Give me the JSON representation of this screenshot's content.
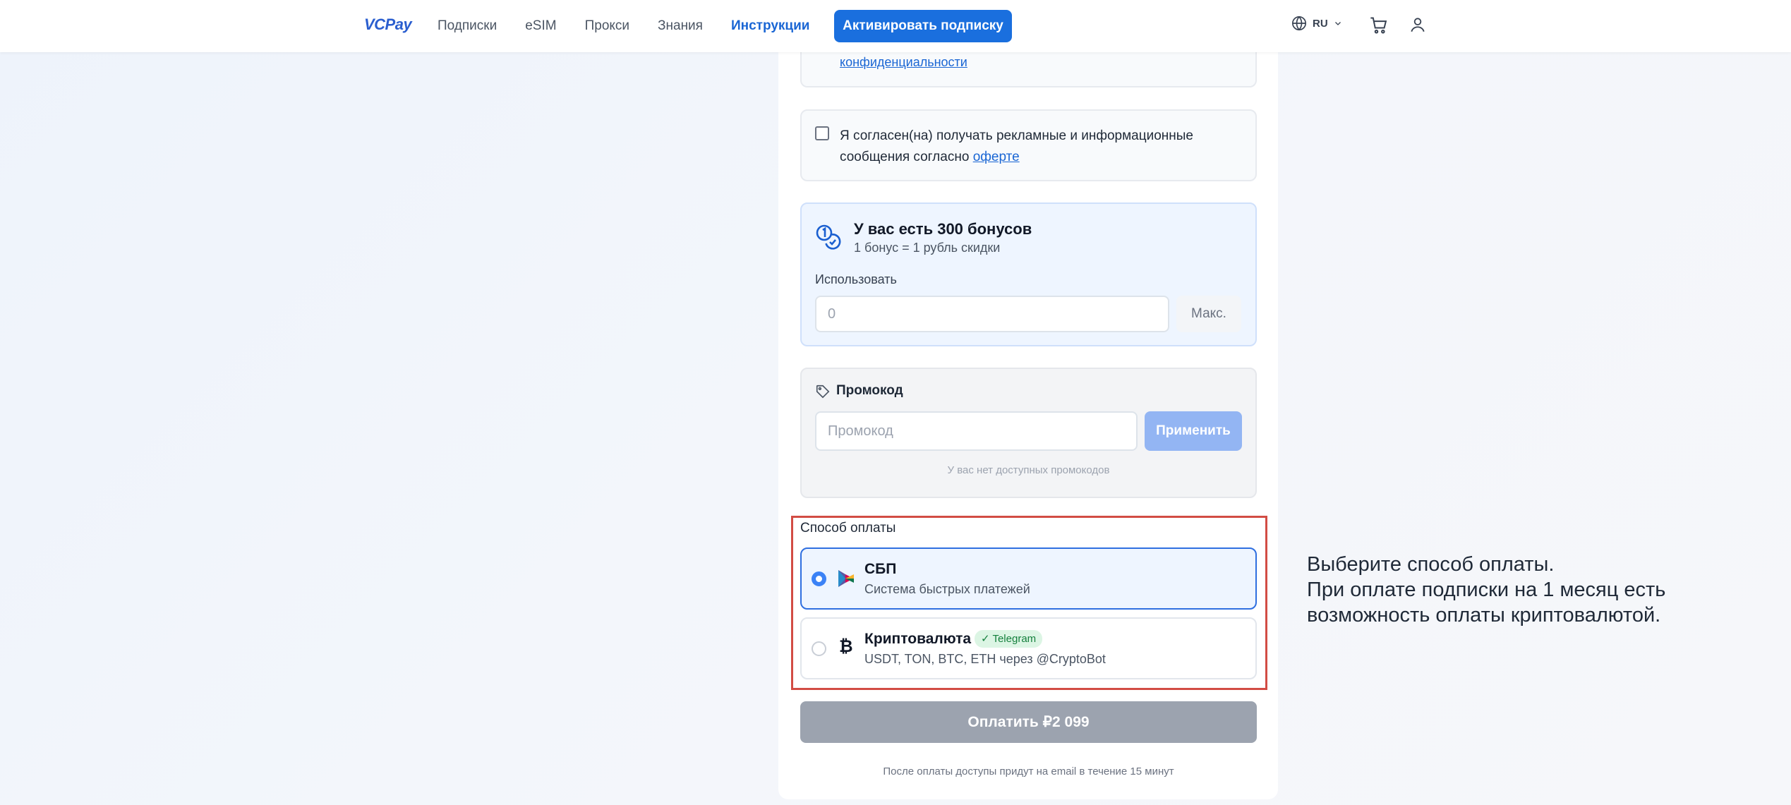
{
  "header": {
    "logo": "VCPay",
    "nav": [
      "Подписки",
      "eSIM",
      "Прокси",
      "Знания",
      "Инструкции"
    ],
    "active_nav": "Инструкции",
    "activate_label": "Активировать подписку",
    "language": "RU"
  },
  "form": {
    "privacy_link": "конфиденциальности",
    "consent": {
      "text": "Я согласен(на) получать рекламные и информационные сообщения согласно ",
      "link": "оферте"
    },
    "bonus": {
      "title": "У вас есть 300 бонусов",
      "subtitle": "1 бонус = 1 рубль скидки",
      "use_label": "Использовать",
      "input_placeholder": "0",
      "max_label": "Макс."
    },
    "promo": {
      "label": "Промокод",
      "input_placeholder": "Промокод",
      "apply_label": "Применить",
      "empty_note": "У вас нет доступных промокодов"
    },
    "payment": {
      "label": "Способ оплаты",
      "options": [
        {
          "title": "СБП",
          "subtitle": "Система быстрых платежей",
          "selected": true
        },
        {
          "title": "Криптовалюта",
          "badge": "✓ Telegram",
          "subtitle": "USDT, TON, BTC, ETH через @CryptoBot",
          "selected": false
        }
      ],
      "pay_button": "Оплатить ₽2 099",
      "after_note": "После оплаты доступы придут на email в течение 15 минут"
    }
  },
  "annotation": {
    "line1": "Выберите способ оплаты.",
    "line2": "При оплате подписки на 1 месяц есть",
    "line3": "возможность оплаты криптовалютой."
  },
  "colors": {
    "accent": "#1a6fde",
    "highlight": "#d24c44",
    "disabled_button": "#9ca3af",
    "badge_bg": "#dcf5e4",
    "badge_text": "#15803d"
  }
}
